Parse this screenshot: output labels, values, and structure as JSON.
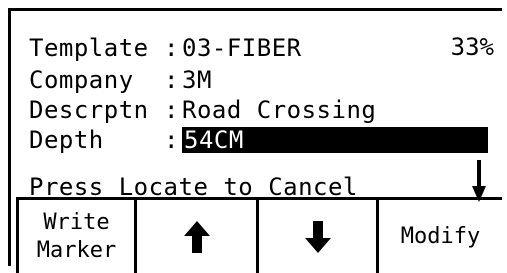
{
  "fields": [
    {
      "label": "Template",
      "value": "03-FIBER"
    },
    {
      "label": "Company",
      "value": "3M"
    },
    {
      "label": "Descrptn",
      "value": "Road Crossing"
    },
    {
      "label": "Depth",
      "value": "54CM"
    }
  ],
  "percent": "33%",
  "message": "Press Locate to Cancel",
  "softkeys": {
    "write_marker": [
      "Write",
      "Marker"
    ],
    "up_icon": "up-arrow-icon",
    "down_icon": "down-arrow-icon",
    "modify": "Modify"
  }
}
